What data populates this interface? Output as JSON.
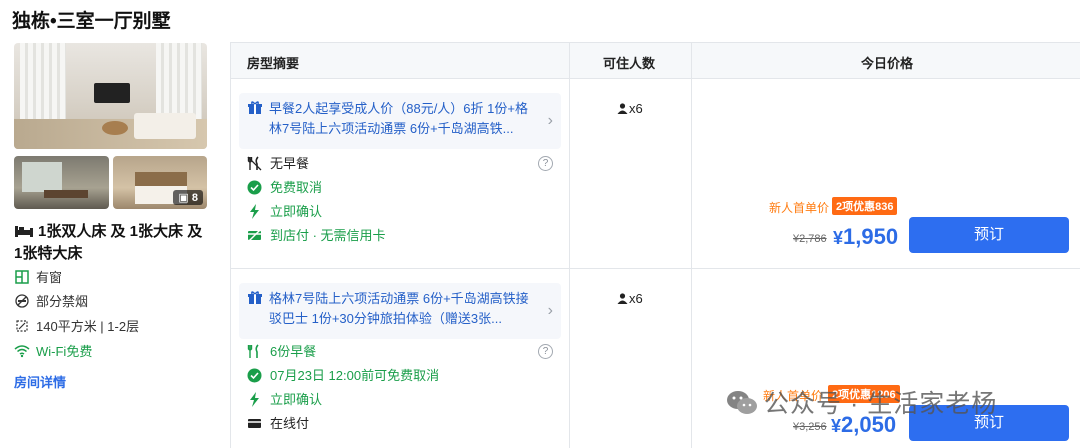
{
  "hotel": {
    "title": "独栋•三室一厅别墅"
  },
  "room": {
    "photo_count": "8",
    "bed": "1张双人床 及 1张大床 及 1张特大床",
    "features": [
      {
        "icon": "window-icon",
        "label": "有窗"
      },
      {
        "icon": "no-smoking-icon",
        "label": "部分禁烟"
      },
      {
        "icon": "area-icon",
        "label": "140平方米 | 1-2层"
      },
      {
        "icon": "wifi-icon",
        "label": "Wi-Fi免费",
        "color": "#1a9e4a"
      }
    ],
    "details_link": "房间详情"
  },
  "table": {
    "headers": {
      "summary": "房型摘要",
      "guests": "可住人数",
      "price": "今日价格"
    },
    "rows": [
      {
        "package": "早餐2人起享受成人价（88元/人）6折 1份+格林7号陆上六项活动通票 6份+千岛湖高铁...",
        "meal": "无早餐",
        "cancel": "免费取消",
        "confirm": "立即确认",
        "payment": "到店付 · 无需信用卡",
        "guests": "x6",
        "promo_label": "新人首单价",
        "promo_badge": "2项优惠836",
        "old_price": "¥2,786",
        "currency": "¥",
        "price": "1,950",
        "book": "预订"
      },
      {
        "package": "格林7号陆上六项活动通票 6份+千岛湖高铁接驳巴士 1份+30分钟旅拍体验（赠送3张...",
        "meal": "6份早餐",
        "cancel": "07月23日 12:00前可免费取消",
        "confirm": "立即确认",
        "payment": "在线付",
        "guests": "x6",
        "promo_label": "新人首单价",
        "promo_badge": "2项优惠1206",
        "old_price": "¥3,256",
        "currency": "¥",
        "price": "2,050",
        "book": "预订"
      }
    ]
  },
  "watermark": "公众号 · 生活家老杨",
  "colors": {
    "accent": "#2d6ce6",
    "green": "#1a9e4a",
    "promo": "#ff6a13"
  }
}
